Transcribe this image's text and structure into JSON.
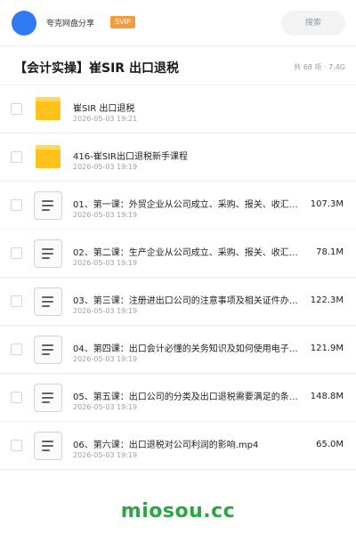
{
  "header": {
    "brand": "夸克网盘分享",
    "badge": "SVIP",
    "search_label": "搜索",
    "avatar_color": "#2f7bf5"
  },
  "folder": {
    "title": "【会计实操】崔SIR 出口退税",
    "meta": "共 68 项 · 7.4G"
  },
  "files": [
    {
      "type": "folder",
      "icon": "folder-icon",
      "name": "崔SIR 出口退税",
      "date": "2026-05-03 19:21",
      "size": ""
    },
    {
      "type": "folder",
      "icon": "folder-icon",
      "name": "416-崔SIR出口退税新手课程",
      "date": "2026-05-03 19:19",
      "size": ""
    },
    {
      "type": "file",
      "icon": "document-icon",
      "name": "01、第一课：外贸企业从公司成立、采购、报关、收汇…",
      "date": "2026-05-03 19:19",
      "size": "107.3M"
    },
    {
      "type": "file",
      "icon": "document-icon",
      "name": "02、第二课：生产企业从公司成立、采购、报关、收汇…",
      "date": "2026-05-03 19:19",
      "size": "78.1M"
    },
    {
      "type": "file",
      "icon": "document-icon",
      "name": "03、第三课：注册进出口公司的注意事项及相关证件办…",
      "date": "2026-05-03 19:19",
      "size": "122.3M"
    },
    {
      "type": "file",
      "icon": "document-icon",
      "name": "04、第四课：出口会计必懂的关务知识及如何使用电子…",
      "date": "2026-05-03 19:19",
      "size": "121.9M"
    },
    {
      "type": "file",
      "icon": "document-icon",
      "name": "05、第五课：出口公司的分类及出口退税需要满足的条…",
      "date": "2026-05-03 19:19",
      "size": "148.8M"
    },
    {
      "type": "file",
      "icon": "document-icon",
      "name": "06、第六课：出口退税对公司利润的影响.mp4",
      "date": "2026-05-03 19:19",
      "size": "65.0M"
    }
  ],
  "watermark": "miosou.cc",
  "colors": {
    "accent": "#2f7bf5",
    "badge": "#f39c3c",
    "folder": "#ffc21c",
    "watermark": "#2aa744"
  }
}
